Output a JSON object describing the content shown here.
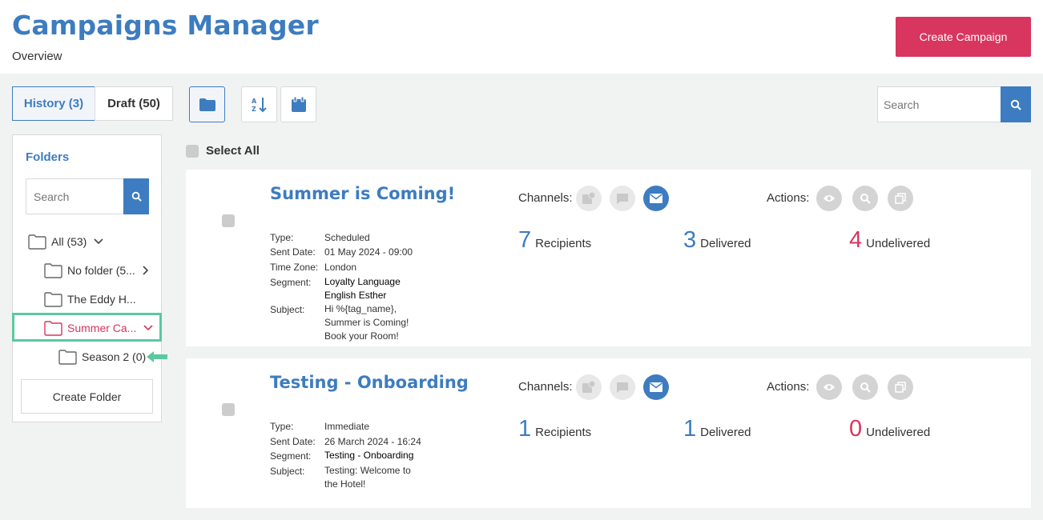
{
  "header": {
    "title": "Campaigns Manager",
    "subtitle": "Overview",
    "create_campaign_label": "Create Campaign"
  },
  "tabs": [
    {
      "label": "History (3)",
      "active": true
    },
    {
      "label": "Draft (50)",
      "active": false
    }
  ],
  "toolbar": {
    "icons": [
      "folder-icon",
      "sort-az-icon",
      "calendar-icon"
    ],
    "search_placeholder": "Search"
  },
  "folders": {
    "title": "Folders",
    "search_placeholder": "Search",
    "items": [
      {
        "label": "All (53)",
        "chevron": "down"
      },
      {
        "label": "No folder (5...",
        "chevron": "right"
      },
      {
        "label": "The Eddy H..."
      },
      {
        "label": "Summer Ca...",
        "chevron": "down",
        "selected": true
      },
      {
        "label": "Season 2 (0)"
      }
    ],
    "create_folder_label": "Create Folder"
  },
  "select_all_label": "Select All",
  "campaigns": [
    {
      "title": "Summer is Coming!",
      "details": [
        {
          "label": "Type:",
          "value": "Scheduled"
        },
        {
          "label": "Sent Date:",
          "value": "01 May 2024 - 09:00"
        },
        {
          "label": "Time Zone:",
          "value": "London"
        },
        {
          "label": "Segment:",
          "value": "Loyalty Language English Esther"
        },
        {
          "label": "Subject:",
          "value": "Hi %{tag_name}, Summer is Coming! Book your Room!"
        }
      ],
      "channels_label": "Channels:",
      "actions_label": "Actions:",
      "stats": {
        "recipients": {
          "value": "7",
          "label": "Recipients"
        },
        "delivered": {
          "value": "3",
          "label": "Delivered"
        },
        "undelivered": {
          "value": "4",
          "label": "Undelivered"
        }
      }
    },
    {
      "title": "Testing - Onboarding",
      "details": [
        {
          "label": "Type:",
          "value": "Immediate"
        },
        {
          "label": "Sent Date:",
          "value": "26 March 2024 - 16:24"
        },
        {
          "label": "Segment:",
          "value": "Testing - Onboarding"
        },
        {
          "label": "Subject:",
          "value": "Testing: Welcome to the Hotel!"
        }
      ],
      "channels_label": "Channels:",
      "actions_label": "Actions:",
      "stats": {
        "recipients": {
          "value": "1",
          "label": "Recipients"
        },
        "delivered": {
          "value": "1",
          "label": "Delivered"
        },
        "undelivered": {
          "value": "0",
          "label": "Undelivered"
        }
      }
    }
  ],
  "colors": {
    "brand_blue": "#3d7cc0",
    "accent_red": "#d8355f",
    "highlight_green": "#5ac9a0"
  }
}
